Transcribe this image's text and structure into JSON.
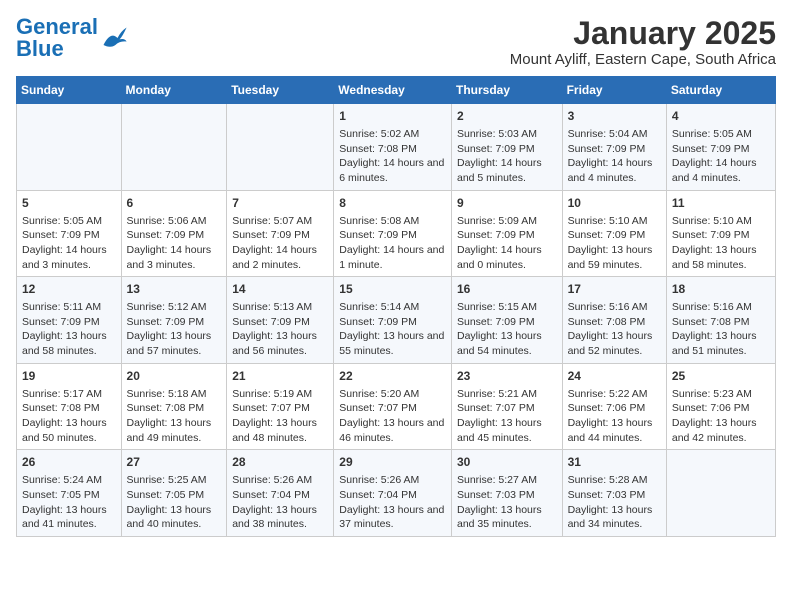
{
  "header": {
    "logo_general": "General",
    "logo_blue": "Blue",
    "title": "January 2025",
    "subtitle": "Mount Ayliff, Eastern Cape, South Africa"
  },
  "days_of_week": [
    "Sunday",
    "Monday",
    "Tuesday",
    "Wednesday",
    "Thursday",
    "Friday",
    "Saturday"
  ],
  "weeks": [
    [
      {
        "day": "",
        "info": ""
      },
      {
        "day": "",
        "info": ""
      },
      {
        "day": "",
        "info": ""
      },
      {
        "day": "1",
        "info": "Sunrise: 5:02 AM\nSunset: 7:08 PM\nDaylight: 14 hours and 6 minutes."
      },
      {
        "day": "2",
        "info": "Sunrise: 5:03 AM\nSunset: 7:09 PM\nDaylight: 14 hours and 5 minutes."
      },
      {
        "day": "3",
        "info": "Sunrise: 5:04 AM\nSunset: 7:09 PM\nDaylight: 14 hours and 4 minutes."
      },
      {
        "day": "4",
        "info": "Sunrise: 5:05 AM\nSunset: 7:09 PM\nDaylight: 14 hours and 4 minutes."
      }
    ],
    [
      {
        "day": "5",
        "info": "Sunrise: 5:05 AM\nSunset: 7:09 PM\nDaylight: 14 hours and 3 minutes."
      },
      {
        "day": "6",
        "info": "Sunrise: 5:06 AM\nSunset: 7:09 PM\nDaylight: 14 hours and 3 minutes."
      },
      {
        "day": "7",
        "info": "Sunrise: 5:07 AM\nSunset: 7:09 PM\nDaylight: 14 hours and 2 minutes."
      },
      {
        "day": "8",
        "info": "Sunrise: 5:08 AM\nSunset: 7:09 PM\nDaylight: 14 hours and 1 minute."
      },
      {
        "day": "9",
        "info": "Sunrise: 5:09 AM\nSunset: 7:09 PM\nDaylight: 14 hours and 0 minutes."
      },
      {
        "day": "10",
        "info": "Sunrise: 5:10 AM\nSunset: 7:09 PM\nDaylight: 13 hours and 59 minutes."
      },
      {
        "day": "11",
        "info": "Sunrise: 5:10 AM\nSunset: 7:09 PM\nDaylight: 13 hours and 58 minutes."
      }
    ],
    [
      {
        "day": "12",
        "info": "Sunrise: 5:11 AM\nSunset: 7:09 PM\nDaylight: 13 hours and 58 minutes."
      },
      {
        "day": "13",
        "info": "Sunrise: 5:12 AM\nSunset: 7:09 PM\nDaylight: 13 hours and 57 minutes."
      },
      {
        "day": "14",
        "info": "Sunrise: 5:13 AM\nSunset: 7:09 PM\nDaylight: 13 hours and 56 minutes."
      },
      {
        "day": "15",
        "info": "Sunrise: 5:14 AM\nSunset: 7:09 PM\nDaylight: 13 hours and 55 minutes."
      },
      {
        "day": "16",
        "info": "Sunrise: 5:15 AM\nSunset: 7:09 PM\nDaylight: 13 hours and 54 minutes."
      },
      {
        "day": "17",
        "info": "Sunrise: 5:16 AM\nSunset: 7:08 PM\nDaylight: 13 hours and 52 minutes."
      },
      {
        "day": "18",
        "info": "Sunrise: 5:16 AM\nSunset: 7:08 PM\nDaylight: 13 hours and 51 minutes."
      }
    ],
    [
      {
        "day": "19",
        "info": "Sunrise: 5:17 AM\nSunset: 7:08 PM\nDaylight: 13 hours and 50 minutes."
      },
      {
        "day": "20",
        "info": "Sunrise: 5:18 AM\nSunset: 7:08 PM\nDaylight: 13 hours and 49 minutes."
      },
      {
        "day": "21",
        "info": "Sunrise: 5:19 AM\nSunset: 7:07 PM\nDaylight: 13 hours and 48 minutes."
      },
      {
        "day": "22",
        "info": "Sunrise: 5:20 AM\nSunset: 7:07 PM\nDaylight: 13 hours and 46 minutes."
      },
      {
        "day": "23",
        "info": "Sunrise: 5:21 AM\nSunset: 7:07 PM\nDaylight: 13 hours and 45 minutes."
      },
      {
        "day": "24",
        "info": "Sunrise: 5:22 AM\nSunset: 7:06 PM\nDaylight: 13 hours and 44 minutes."
      },
      {
        "day": "25",
        "info": "Sunrise: 5:23 AM\nSunset: 7:06 PM\nDaylight: 13 hours and 42 minutes."
      }
    ],
    [
      {
        "day": "26",
        "info": "Sunrise: 5:24 AM\nSunset: 7:05 PM\nDaylight: 13 hours and 41 minutes."
      },
      {
        "day": "27",
        "info": "Sunrise: 5:25 AM\nSunset: 7:05 PM\nDaylight: 13 hours and 40 minutes."
      },
      {
        "day": "28",
        "info": "Sunrise: 5:26 AM\nSunset: 7:04 PM\nDaylight: 13 hours and 38 minutes."
      },
      {
        "day": "29",
        "info": "Sunrise: 5:26 AM\nSunset: 7:04 PM\nDaylight: 13 hours and 37 minutes."
      },
      {
        "day": "30",
        "info": "Sunrise: 5:27 AM\nSunset: 7:03 PM\nDaylight: 13 hours and 35 minutes."
      },
      {
        "day": "31",
        "info": "Sunrise: 5:28 AM\nSunset: 7:03 PM\nDaylight: 13 hours and 34 minutes."
      },
      {
        "day": "",
        "info": ""
      }
    ]
  ]
}
